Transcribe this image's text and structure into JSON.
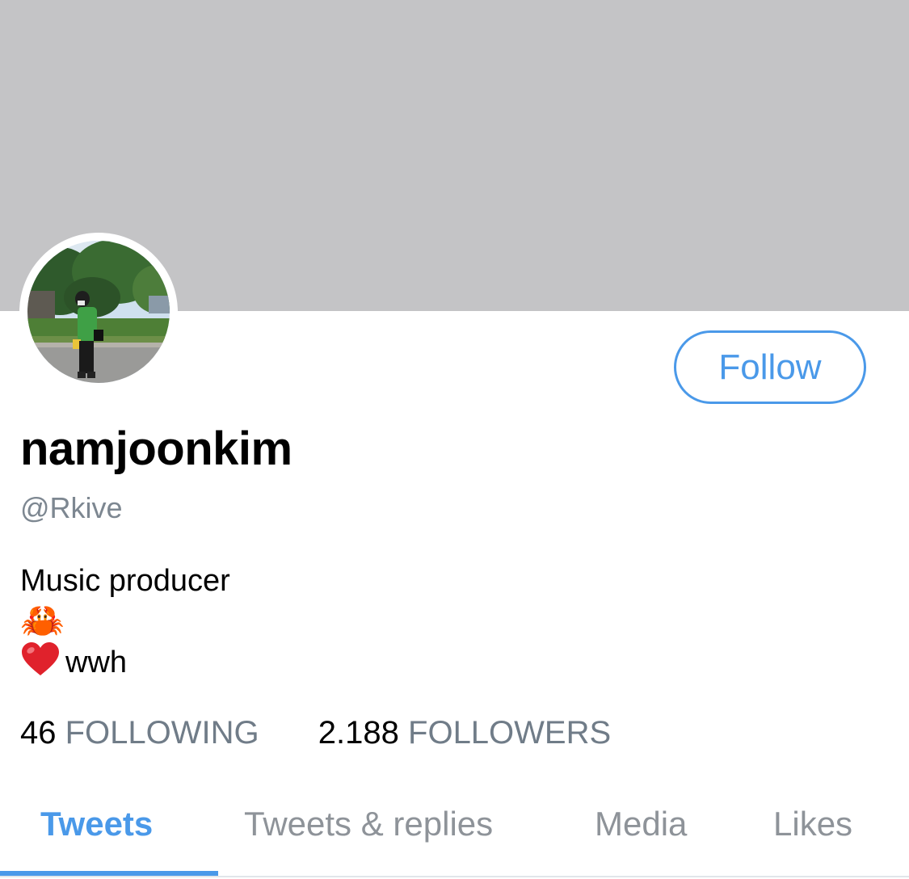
{
  "profile": {
    "display_name": "namjoonkim",
    "handle": "@Rkive",
    "bio_lines": [
      "Music producer",
      "🦀",
      "wwh"
    ],
    "bio_heart_icon": "heart-emoji"
  },
  "actions": {
    "follow_label": "Follow"
  },
  "stats": {
    "following_count": "46",
    "following_label": "FOLLOWING",
    "followers_count": "2.188",
    "followers_label": "FOLLOWERS"
  },
  "tabs": [
    {
      "label": "Tweets",
      "active": true
    },
    {
      "label": "Tweets & replies",
      "active": false
    },
    {
      "label": "Media",
      "active": false
    },
    {
      "label": "Likes",
      "active": false
    }
  ],
  "colors": {
    "accent": "#4a99e9",
    "banner": "#c4c4c6",
    "secondary_text": "#7d8791"
  }
}
